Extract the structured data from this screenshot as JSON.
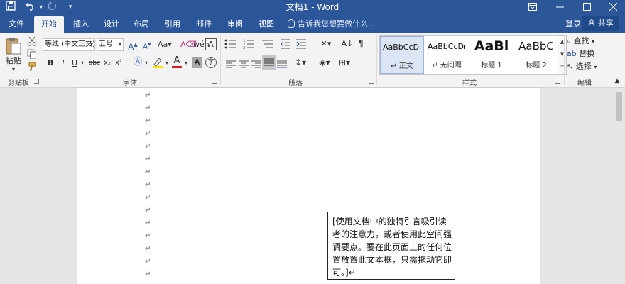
{
  "window": {
    "title": "文档1 - Word"
  },
  "quick_access": {
    "save_icon": "save-icon",
    "undo_icon": "undo-icon",
    "redo_icon": "redo-icon",
    "customize_icon": "customize-icon"
  },
  "window_controls": {
    "ribbon_options": "ribbon-display-options-icon",
    "minimize": "minimize-icon",
    "maximize": "maximize-icon",
    "close": "close-icon"
  },
  "tabs": [
    {
      "label": "文件"
    },
    {
      "label": "开始"
    },
    {
      "label": "插入"
    },
    {
      "label": "设计"
    },
    {
      "label": "布局"
    },
    {
      "label": "引用"
    },
    {
      "label": "邮件"
    },
    {
      "label": "审阅"
    },
    {
      "label": "视图"
    }
  ],
  "active_tab": "开始",
  "tell_me": {
    "placeholder": "告诉我您想要做什么..."
  },
  "account": {
    "login": "登录",
    "share": "共享"
  },
  "clipboard": {
    "paste_label": "粘贴",
    "group_label": "剪贴板"
  },
  "font": {
    "font_name": "等线 (中文正文)",
    "font_size": "五号",
    "group_label": "字体",
    "buttons": {
      "bold": "B",
      "italic": "I",
      "underline": "U",
      "strike": "abc",
      "subscript": "x₂",
      "superscript": "x²"
    }
  },
  "paragraph": {
    "group_label": "段落"
  },
  "styles": {
    "group_label": "样式",
    "items": [
      {
        "sample": "AaBbCcDı",
        "name": "↵ 正文"
      },
      {
        "sample": "AaBbCcDı",
        "name": "↵ 无间隔"
      },
      {
        "sample": "AaBl",
        "name": "标题 1"
      },
      {
        "sample": "AaBbC",
        "name": "标题 2"
      }
    ]
  },
  "editing": {
    "group_label": "编辑",
    "find": "查找",
    "replace": "替换",
    "select": "选择"
  },
  "document": {
    "paragraph_mark": "↵",
    "textbox_text": "[使用文档中的独特引言吸引读者的注意力，或者使用此空间强调要点。要在此页面上的任何位置放置此文本框，只需拖动它即可。]↵"
  }
}
